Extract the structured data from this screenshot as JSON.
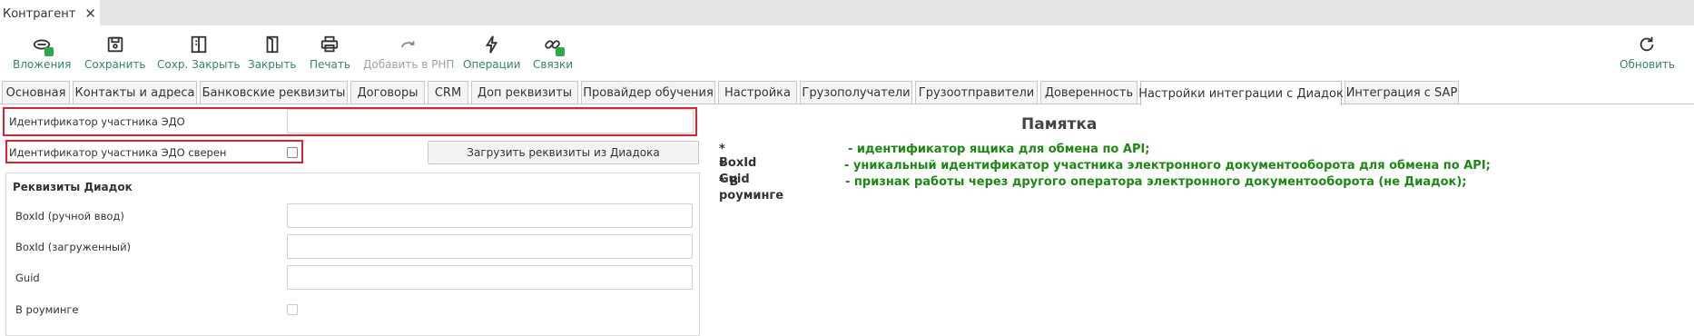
{
  "window": {
    "tab_title": "Контрагент"
  },
  "toolbar": {
    "buttons": [
      {
        "label": "Вложения",
        "icon": "paperclip-icon",
        "enabled": true
      },
      {
        "label": "Сохранить",
        "icon": "save-icon",
        "enabled": true
      },
      {
        "label": "Сохр. Закрыть",
        "icon": "save-close-icon",
        "enabled": true
      },
      {
        "label": "Закрыть",
        "icon": "door-icon",
        "enabled": true
      },
      {
        "label": "Печать",
        "icon": "printer-icon",
        "enabled": true
      },
      {
        "label": "Добавить в РНП",
        "icon": "redo-icon",
        "enabled": false
      },
      {
        "label": "Операции",
        "icon": "lightning-icon",
        "enabled": true
      },
      {
        "label": "Связки",
        "icon": "link-icon",
        "enabled": true
      }
    ],
    "refresh_label": "Обновить"
  },
  "tabs": [
    {
      "label": "Основная"
    },
    {
      "label": "Контакты и адреса"
    },
    {
      "label": "Банковские реквизиты"
    },
    {
      "label": "Договоры"
    },
    {
      "label": "CRM"
    },
    {
      "label": "Доп реквизиты"
    },
    {
      "label": "Провайдер обучения"
    },
    {
      "label": "Настройка"
    },
    {
      "label": "Грузополучатели"
    },
    {
      "label": "Грузоотправители"
    },
    {
      "label": "Доверенность"
    },
    {
      "label": "Настройки интеграции с Диадок",
      "active": true
    },
    {
      "label": "Интеграция с SAP"
    }
  ],
  "form": {
    "edo_id_label": "Идентификатор участника ЭДО",
    "edo_id_value": "",
    "edo_verified_label": "Идентификатор участника ЭДО сверен",
    "edo_verified_checked": false,
    "load_button": "Загрузить реквизиты из Диадока",
    "group_title": "Реквизиты Диадок",
    "boxid_manual_label": "BoxId (ручной ввод)",
    "boxid_manual_value": "",
    "boxid_loaded_label": "BoxId (загруженный)",
    "boxid_loaded_value": "",
    "guid_label": "Guid",
    "guid_value": "",
    "roaming_label": "В роуминге",
    "roaming_checked": false
  },
  "memo": {
    "title": "Памятка",
    "items": [
      {
        "key": "* BoxId",
        "text": "- идентификатор ящика для обмена по API;"
      },
      {
        "key": "* Guid",
        "text": "- уникальный идентификатор участника электронного документооборота для обмена по API;"
      },
      {
        "key": "* В роуминге",
        "text": "- признак работы через другого оператора электронного документооборота (не Диадок);"
      }
    ]
  },
  "colors": {
    "accent_green": "#2e8b57",
    "memo_green": "#1a8a10",
    "highlight_red": "#d9262c"
  }
}
